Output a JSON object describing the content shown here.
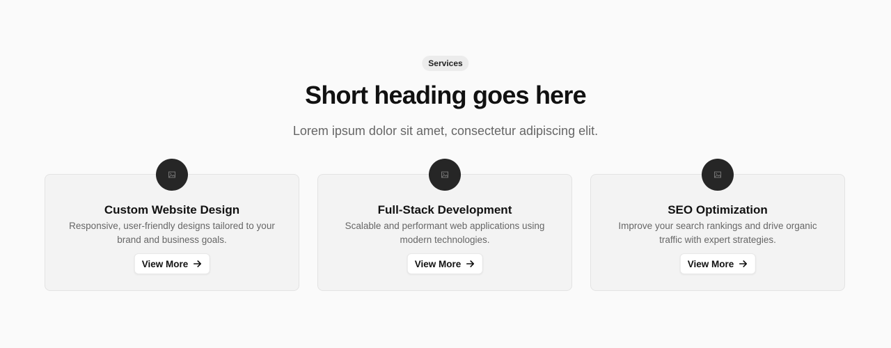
{
  "section": {
    "badge": "Services",
    "heading": "Short heading goes here",
    "subheading": "Lorem ipsum dolor sit amet, consectetur adipiscing elit."
  },
  "cards": [
    {
      "icon": "image-placeholder-icon",
      "title": "Custom Website Design",
      "description": "Responsive, user-friendly designs tailored to your brand and business goals.",
      "button_label": "View More",
      "button_icon": "arrow-right-icon"
    },
    {
      "icon": "image-placeholder-icon",
      "title": "Full-Stack Development",
      "description": "Scalable and performant web applications using modern technologies.",
      "button_label": "View More",
      "button_icon": "arrow-right-icon"
    },
    {
      "icon": "image-placeholder-icon",
      "title": "SEO Optimization",
      "description": "Improve your search rankings and drive organic traffic with expert strategies.",
      "button_label": "View More",
      "button_icon": "arrow-right-icon"
    }
  ],
  "colors": {
    "background": "#fafafa",
    "card_background": "#f3f3f3",
    "icon_circle": "#262626",
    "heading_text": "#111111",
    "muted_text": "#666666",
    "badge_background": "#ececec"
  }
}
